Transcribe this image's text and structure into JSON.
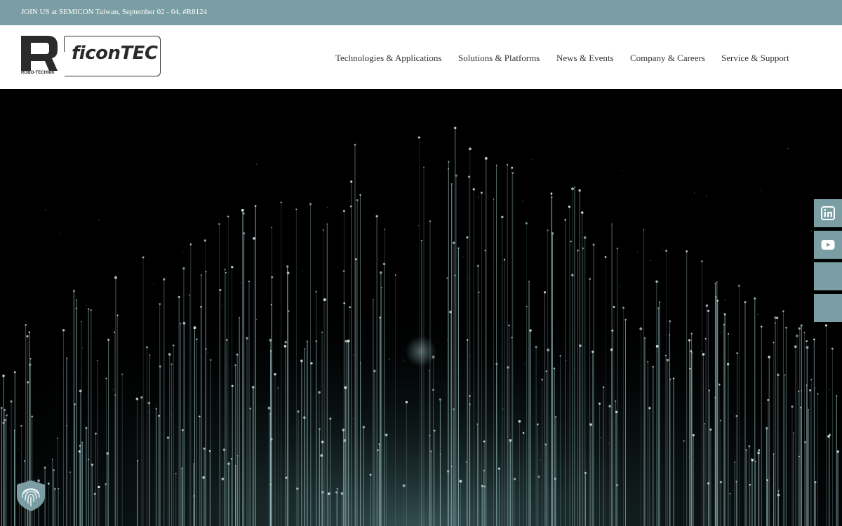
{
  "topbar": {
    "announcement": "JOIN US at SEMICON Taiwan, September 02 - 04, #R8124"
  },
  "logo": {
    "brand": "ficonTEC",
    "subbrand": "ROBO-TECHNIK"
  },
  "nav": {
    "items": [
      {
        "label": "Technologies & Applications"
      },
      {
        "label": "Solutions & Platforms"
      },
      {
        "label": "News & Events"
      },
      {
        "label": "Company & Careers"
      },
      {
        "label": "Service & Support"
      }
    ]
  },
  "social": {
    "buttons": [
      {
        "icon": "linkedin-icon"
      },
      {
        "icon": "youtube-icon"
      },
      {
        "icon": "social-icon"
      },
      {
        "icon": "social-icon"
      }
    ]
  },
  "privacy": {
    "icon": "fingerprint-shield-icon"
  },
  "colors": {
    "accent": "#7a9ea3",
    "hero_bg": "#000000",
    "fiber": "#8fb3b6"
  }
}
